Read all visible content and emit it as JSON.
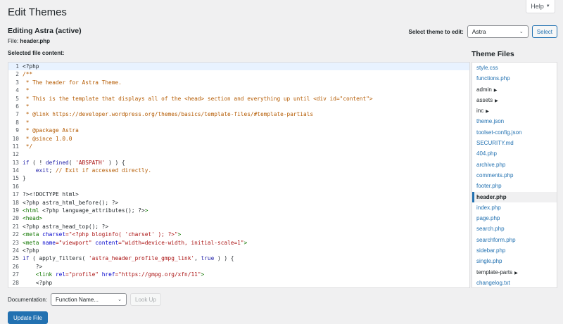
{
  "help_tab": {
    "label": "Help"
  },
  "page_title": "Edit Themes",
  "editing_title": "Editing Astra (active)",
  "file_label": "File:",
  "file_name": "header.php",
  "selected_label": "Selected file content:",
  "theme_select": {
    "label": "Select theme to edit:",
    "value": "Astra",
    "button": "Select"
  },
  "code_lines": [
    [
      {
        "t": "<?php",
        "c": "def"
      }
    ],
    [
      {
        "t": "/**",
        "c": "comment"
      }
    ],
    [
      {
        "t": " * The header for Astra Theme.",
        "c": "comment"
      }
    ],
    [
      {
        "t": " *",
        "c": "comment"
      }
    ],
    [
      {
        "t": " * This is the template that displays all of the <head> section and everything up until <div id=\"content\">",
        "c": "comment"
      }
    ],
    [
      {
        "t": " *",
        "c": "comment"
      }
    ],
    [
      {
        "t": " * @link https://developer.wordpress.org/themes/basics/template-files/#template-partials",
        "c": "comment"
      }
    ],
    [
      {
        "t": " *",
        "c": "comment"
      }
    ],
    [
      {
        "t": " * @package Astra",
        "c": "comment"
      }
    ],
    [
      {
        "t": " * @since 1.0.0",
        "c": "comment"
      }
    ],
    [
      {
        "t": " */",
        "c": "comment"
      }
    ],
    [],
    [
      {
        "t": "if",
        "c": "kw"
      },
      {
        "t": " ( ! ",
        "c": "def"
      },
      {
        "t": "defined",
        "c": "kw"
      },
      {
        "t": "( ",
        "c": "def"
      },
      {
        "t": "'ABSPATH'",
        "c": "str"
      },
      {
        "t": " ) ) {",
        "c": "def"
      }
    ],
    [
      {
        "t": "    ",
        "c": "def"
      },
      {
        "t": "exit",
        "c": "kw"
      },
      {
        "t": "; ",
        "c": "def"
      },
      {
        "t": "// Exit if accessed directly.",
        "c": "comment"
      }
    ],
    [
      {
        "t": "}",
        "c": "def"
      }
    ],
    [],
    [
      {
        "t": "?><!DOCTYPE html>",
        "c": "def"
      }
    ],
    [
      {
        "t": "<?php astra_html_before(); ?>",
        "c": "def"
      }
    ],
    [
      {
        "t": "<html",
        "c": "tag"
      },
      {
        "t": " <?php language_attributes(); ?>",
        "c": "def"
      },
      {
        "t": ">",
        "c": "tag"
      }
    ],
    [
      {
        "t": "<head>",
        "c": "tag"
      }
    ],
    [
      {
        "t": "<?php astra_head_top(); ?>",
        "c": "def"
      }
    ],
    [
      {
        "t": "<meta",
        "c": "tag"
      },
      {
        "t": " charset",
        "c": "attr"
      },
      {
        "t": "=\"<?php bloginfo( 'charset' ); ?>\"",
        "c": "str"
      },
      {
        "t": ">",
        "c": "tag"
      }
    ],
    [
      {
        "t": "<meta",
        "c": "tag"
      },
      {
        "t": " name",
        "c": "attr"
      },
      {
        "t": "=\"viewport\"",
        "c": "str"
      },
      {
        "t": " content",
        "c": "attr"
      },
      {
        "t": "=\"width=device-width, initial-scale=1\"",
        "c": "str"
      },
      {
        "t": ">",
        "c": "tag"
      }
    ],
    [
      {
        "t": "<?php",
        "c": "def"
      }
    ],
    [
      {
        "t": "if",
        "c": "kw"
      },
      {
        "t": " ( apply_filters( ",
        "c": "def"
      },
      {
        "t": "'astra_header_profile_gmpg_link'",
        "c": "str"
      },
      {
        "t": ", ",
        "c": "def"
      },
      {
        "t": "true",
        "c": "kw"
      },
      {
        "t": " ) ) {",
        "c": "def"
      }
    ],
    [
      {
        "t": "    ?>",
        "c": "def"
      }
    ],
    [
      {
        "t": "    ",
        "c": "def"
      },
      {
        "t": "<link",
        "c": "tag"
      },
      {
        "t": " rel",
        "c": "attr"
      },
      {
        "t": "=\"profile\"",
        "c": "str"
      },
      {
        "t": " href",
        "c": "attr"
      },
      {
        "t": "=\"https://gmpg.org/xfn/11\"",
        "c": "str"
      },
      {
        "t": ">",
        "c": "tag"
      }
    ],
    [
      {
        "t": "    <?php",
        "c": "def"
      }
    ],
    [
      {
        "t": "}",
        "c": "def"
      }
    ],
    [
      {
        "t": "?>",
        "c": "def"
      }
    ]
  ],
  "sidebar": {
    "title": "Theme Files",
    "files": [
      {
        "name": "style.css",
        "type": "file"
      },
      {
        "name": "functions.php",
        "type": "file"
      },
      {
        "name": "admin",
        "type": "folder"
      },
      {
        "name": "assets",
        "type": "folder"
      },
      {
        "name": "inc",
        "type": "folder"
      },
      {
        "name": "theme.json",
        "type": "file"
      },
      {
        "name": "toolset-config.json",
        "type": "file"
      },
      {
        "name": "SECURITY.md",
        "type": "file"
      },
      {
        "name": "404.php",
        "type": "file"
      },
      {
        "name": "archive.php",
        "type": "file"
      },
      {
        "name": "comments.php",
        "type": "file"
      },
      {
        "name": "footer.php",
        "type": "file"
      },
      {
        "name": "header.php",
        "type": "file",
        "current": true
      },
      {
        "name": "index.php",
        "type": "file"
      },
      {
        "name": "page.php",
        "type": "file"
      },
      {
        "name": "search.php",
        "type": "file"
      },
      {
        "name": "searchform.php",
        "type": "file"
      },
      {
        "name": "sidebar.php",
        "type": "file"
      },
      {
        "name": "single.php",
        "type": "file"
      },
      {
        "name": "template-parts",
        "type": "folder"
      },
      {
        "name": "changelog.txt",
        "type": "file"
      }
    ]
  },
  "documentation": {
    "label": "Documentation:",
    "placeholder": "Function Name...",
    "lookup_button": "Look Up"
  },
  "update_button": "Update File",
  "colors": {
    "accent": "#2271b1",
    "background": "#f0f0f1",
    "active_line": "#e8f2ff"
  }
}
